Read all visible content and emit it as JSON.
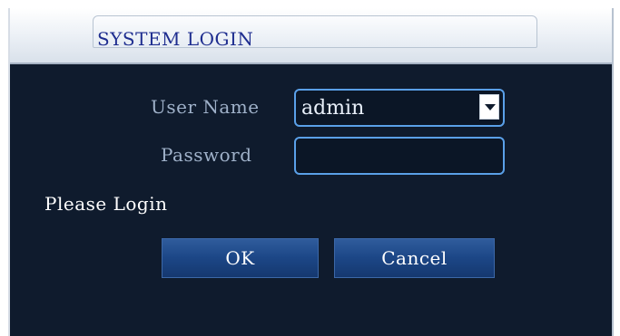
{
  "dialog": {
    "title": "SYSTEM LOGIN"
  },
  "form": {
    "user_name_label": "User Name",
    "user_name_value": "admin",
    "password_label": "Password",
    "password_value": ""
  },
  "status_text": "Please Login",
  "buttons": {
    "ok_label": "OK",
    "cancel_label": "Cancel"
  },
  "icons": {
    "dropdown": "chevron-down-icon"
  },
  "colors": {
    "background": "#0f1b2d",
    "field_border": "#5aa0e8",
    "button": "#1c4686",
    "title_text": "#1e2d8f"
  }
}
